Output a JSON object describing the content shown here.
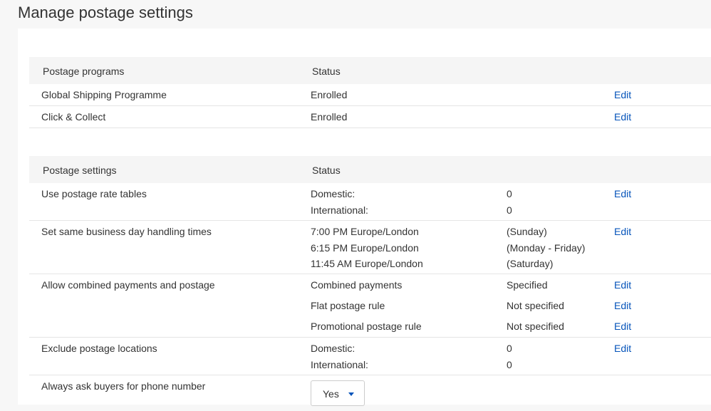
{
  "page_title": "Manage postage settings",
  "programs": {
    "header": {
      "col1": "Postage programs",
      "col2": "Status"
    },
    "rows": [
      {
        "name": "Global Shipping Programme",
        "status": "Enrolled",
        "edit": "Edit"
      },
      {
        "name": "Click & Collect",
        "status": "Enrolled",
        "edit": "Edit"
      }
    ]
  },
  "settings": {
    "header": {
      "col1": "Postage settings",
      "col2": "Status"
    },
    "rate_tables": {
      "name": "Use postage rate tables",
      "domestic_label": "Domestic:",
      "domestic_value": "0",
      "international_label": "International:",
      "international_value": "0",
      "edit": "Edit"
    },
    "handling_times": {
      "name": "Set same business day handling times",
      "times": [
        {
          "time": "7:00 PM Europe/London",
          "days": "(Sunday)"
        },
        {
          "time": "6:15 PM Europe/London",
          "days": "(Monday - Friday)"
        },
        {
          "time": "11:45 AM Europe/London",
          "days": "(Saturday)"
        }
      ],
      "edit": "Edit"
    },
    "combined": {
      "name": "Allow combined payments and postage",
      "items": [
        {
          "label": "Combined payments",
          "value": "Specified",
          "edit": "Edit"
        },
        {
          "label": "Flat postage rule",
          "value": "Not specified",
          "edit": "Edit"
        },
        {
          "label": "Promotional postage rule",
          "value": "Not specified",
          "edit": "Edit"
        }
      ]
    },
    "exclude": {
      "name": "Exclude postage locations",
      "domestic_label": "Domestic:",
      "domestic_value": "0",
      "international_label": "International:",
      "international_value": "0",
      "edit": "Edit"
    },
    "phone": {
      "name": "Always ask buyers for phone number",
      "selected": "Yes"
    }
  }
}
